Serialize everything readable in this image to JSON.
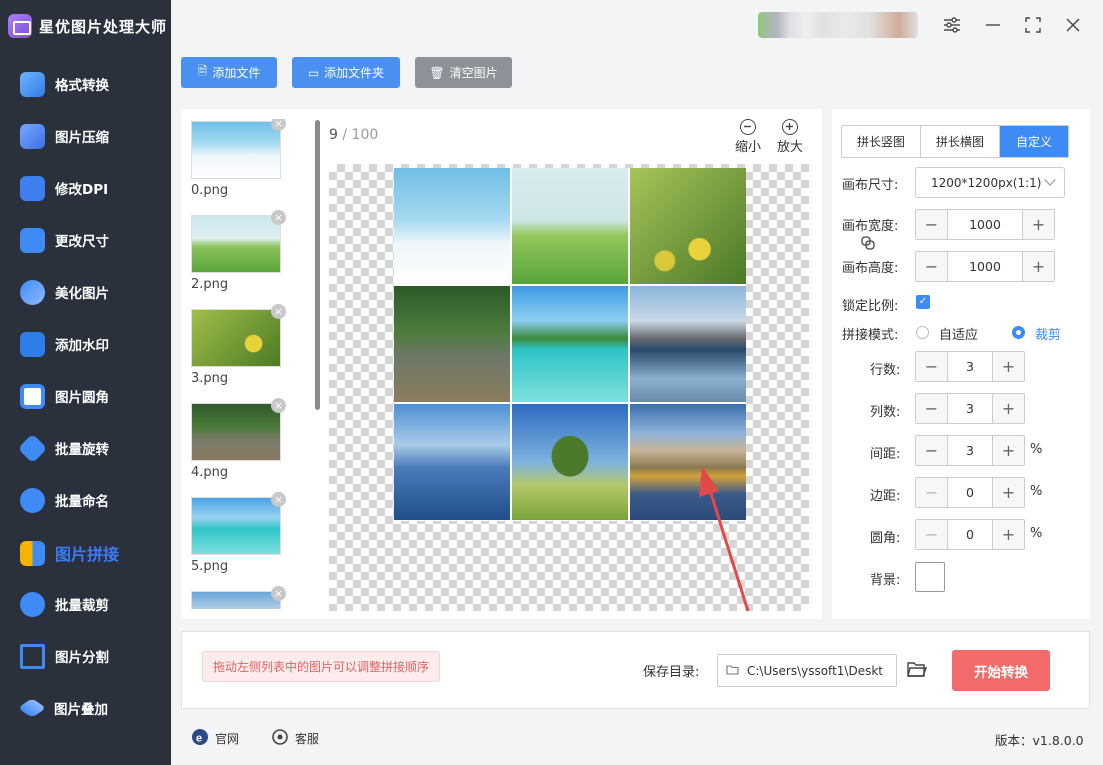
{
  "app": {
    "title": "星优图片处理大师"
  },
  "sidebar": {
    "items": [
      {
        "label": "格式转换",
        "icon": "format-convert-icon",
        "active": false
      },
      {
        "label": "图片压缩",
        "icon": "compress-icon",
        "active": false
      },
      {
        "label": "修改DPI",
        "icon": "dpi-icon",
        "active": false
      },
      {
        "label": "更改尺寸",
        "icon": "resize-icon",
        "active": false
      },
      {
        "label": "美化图片",
        "icon": "beautify-icon",
        "active": false
      },
      {
        "label": "添加水印",
        "icon": "watermark-icon",
        "active": false
      },
      {
        "label": "图片圆角",
        "icon": "round-corner-icon",
        "active": false
      },
      {
        "label": "批量旋转",
        "icon": "rotate-icon",
        "active": false
      },
      {
        "label": "批量命名",
        "icon": "rename-icon",
        "active": false
      },
      {
        "label": "图片拼接",
        "icon": "stitch-icon",
        "active": true
      },
      {
        "label": "批量裁剪",
        "icon": "crop-icon",
        "active": false
      },
      {
        "label": "图片分割",
        "icon": "split-icon",
        "active": false
      },
      {
        "label": "图片叠加",
        "icon": "overlay-icon",
        "active": false
      }
    ]
  },
  "toolbar": {
    "add_file": "添加文件",
    "add_folder": "添加文件夹",
    "clear": "清空图片"
  },
  "file_list": {
    "items": [
      "0.png",
      "2.png",
      "3.png",
      "4.png",
      "5.png",
      ""
    ]
  },
  "preview": {
    "current": "9",
    "total": "100",
    "separator": "/",
    "zoom_out": "缩小",
    "zoom_in": "放大"
  },
  "settings": {
    "tabs": [
      "拼长竖图",
      "拼长横图",
      "自定义"
    ],
    "active_tab": "自定义",
    "canvas_size_label": "画布尺寸:",
    "canvas_size_value": "1200*1200px(1:1)",
    "canvas_width_label": "画布宽度:",
    "canvas_width": "1000",
    "canvas_height_label": "画布高度:",
    "canvas_height": "1000",
    "lock_ratio_label": "锁定比例:",
    "lock_ratio": true,
    "mode_label": "拼接模式:",
    "mode_options": [
      "自适应",
      "裁剪"
    ],
    "mode_selected": "裁剪",
    "rows_label": "行数:",
    "rows": "3",
    "cols_label": "列数:",
    "cols": "3",
    "gap_label": "间距:",
    "gap": "3",
    "margin_label": "边距:",
    "margin": "0",
    "radius_label": "圆角:",
    "radius": "0",
    "percent": "%",
    "bg_label": "背景:",
    "bg_color": "#ffffff"
  },
  "bottom": {
    "hint": "拖动左侧列表中的图片可以调整拼接顺序",
    "save_label": "保存目录:",
    "save_path": "C:\\Users\\yssoft1\\Deskt",
    "start": "开始转换"
  },
  "footer": {
    "website": "官网",
    "support": "客服",
    "version": "版本：v1.8.0.0"
  },
  "colors": {
    "accent": "#3e8bf6",
    "sidebar_bg": "#2a313d",
    "start_btn": "#f26a6a"
  }
}
